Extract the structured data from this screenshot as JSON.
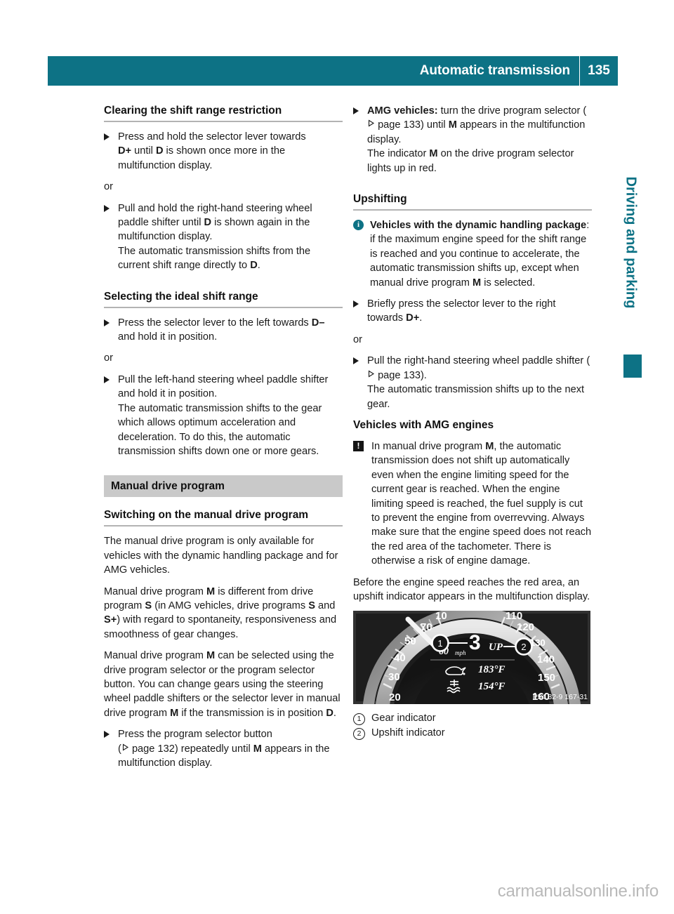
{
  "header": {
    "title": "Automatic transmission",
    "page_number": "135"
  },
  "side_tab": {
    "label": "Driving and parking"
  },
  "left_column": {
    "heading_1": "Clearing the shift range restriction",
    "step_1_line1": "Press and hold the selector lever towards",
    "step_1_bold_1": "D+",
    "step_1_mid_1": " until ",
    "step_1_bold_2": "D",
    "step_1_tail": " is shown once more in the multifunction display.",
    "or_1": "or",
    "step_2_line1": "Pull and hold the right-hand steering wheel paddle shifter until ",
    "step_2_bold_1": "D",
    "step_2_tail": " is shown again in the multifunction display.",
    "step_2_result_head": "The automatic transmission shifts from the current shift range directly to ",
    "step_2_result_bold": "D",
    "step_2_result_tail": ".",
    "heading_2": "Selecting the ideal shift range",
    "step_3_line1": "Press the selector lever to the left towards ",
    "step_3_bold_1": "D–",
    "step_3_tail": " and hold it in position.",
    "or_2": "or",
    "step_4_line1": "Pull the left-hand steering wheel paddle shifter and hold it in position.",
    "step_4_result": "The automatic transmission shifts to the gear which allows optimum acceleration and deceleration. To do this, the automatic transmission shifts down one or more gears.",
    "section_banner": "Manual drive program",
    "heading_3": "Switching on the manual drive program",
    "para_1": "The manual drive program is only available for vehicles with the dynamic handling package and for AMG vehicles.",
    "para_2_a": "Manual drive program ",
    "para_2_b_M": "M",
    "para_2_c": " is different from drive program ",
    "para_2_b_S": "S",
    "para_2_d": " (in AMG vehicles, drive programs ",
    "para_2_b_S2": "S",
    "para_2_e": " and ",
    "para_2_b_Splus": "S+",
    "para_2_f": ") with regard to spontaneity, responsiveness and smoothness of gear changes.",
    "para_3_a": "Manual drive program ",
    "para_3_b_M": "M",
    "para_3_c": " can be selected using the drive program selector or the program selector button. You can change gears using the steering wheel paddle shifters or the selector lever in manual drive program ",
    "para_3_b_M2": "M",
    "para_3_d": " if the transmission is in position ",
    "para_3_b_D": "D",
    "para_3_e": ".",
    "step_5_a": "Press the program selector button",
    "step_5_ref": "page 132",
    "step_5_b": ") repeatedly until ",
    "step_5_bold_M": "M",
    "step_5_c": " appears in the multifunction display."
  },
  "right_column": {
    "step_1_bold": "AMG vehicles:",
    "step_1_a": " turn the drive program selector (",
    "step_1_ref": "page 133",
    "step_1_b": ") until ",
    "step_1_bold_M": "M",
    "step_1_c": " appears in the multifunction display.",
    "step_1_result_a": "The indicator ",
    "step_1_result_bold_M": "M",
    "step_1_result_b": " on the drive program selector lights up in red.",
    "heading_upshifting": "Upshifting",
    "note_bold_1": "Vehicles with the dynamic handling package",
    "note_text": ": if the maximum engine speed for the shift range is reached and you continue to accelerate, the automatic transmission shifts up, except when manual drive program ",
    "note_bold_M": "M",
    "note_tail": " is selected.",
    "step_2_a": "Briefly press the selector lever to the right towards ",
    "step_2_bold": "D+",
    "step_2_b": ".",
    "or_1": "or",
    "step_3_a": "Pull the right-hand steering wheel paddle shifter (",
    "step_3_ref": "page 133",
    "step_3_b": ").",
    "step_3_result": "The automatic transmission shifts up to the next gear.",
    "heading_amg_engines": "Vehicles with AMG engines",
    "warn_a": "In manual drive program ",
    "warn_bold_M": "M",
    "warn_b": ", the automatic transmission does not shift up automatically even when the engine limiting speed for the current gear is reached. When the engine limiting speed is reached, the fuel supply is cut to prevent the engine from overrevving. Always make sure that the engine speed does not reach the red area of the tachometer. There is otherwise a risk of engine damage.",
    "para_before": "Before the engine speed reaches the red area, an upshift indicator appears in the multifunction display.",
    "caption_1_num": "1",
    "caption_1_text": "Gear indicator",
    "caption_2_num": "2",
    "caption_2_text": "Upshift indicator"
  },
  "cluster_image": {
    "speed_ticks": [
      "20",
      "30",
      "40",
      "50",
      "70",
      "110",
      "120",
      "130",
      "140",
      "150",
      "160"
    ],
    "gear_value": "3",
    "speed_digital": "60",
    "speed_unit": "mph",
    "upshift_label": "UP",
    "oil_temp": "183°F",
    "coolant_temp": "154°F",
    "callout_1": "1",
    "callout_2": "2",
    "image_code": "P54.32-9 167-31"
  },
  "footer": {
    "watermark": "carmanualsonline.info"
  },
  "colors": {
    "teal": "#0d7285",
    "banner_gray": "#c9c9c9",
    "rule_gray": "#b3b3b3"
  }
}
